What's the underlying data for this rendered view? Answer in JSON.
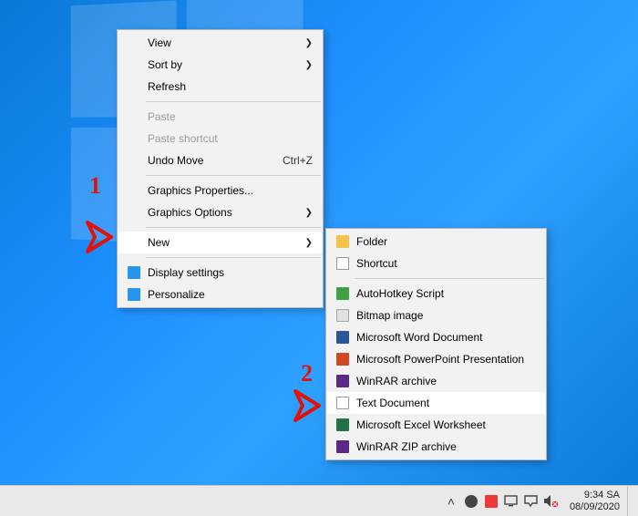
{
  "menu1": {
    "view": "View",
    "sortby": "Sort by",
    "refresh": "Refresh",
    "paste": "Paste",
    "paste_shortcut": "Paste shortcut",
    "undo_move": "Undo Move",
    "undo_accel": "Ctrl+Z",
    "gfx_props": "Graphics Properties...",
    "gfx_opts": "Graphics Options",
    "new": "New",
    "display": "Display settings",
    "personalize": "Personalize"
  },
  "menu2": {
    "folder": "Folder",
    "shortcut": "Shortcut",
    "ahk": "AutoHotkey Script",
    "bmp": "Bitmap image",
    "word": "Microsoft Word Document",
    "ppt": "Microsoft PowerPoint Presentation",
    "rar": "WinRAR archive",
    "txt": "Text Document",
    "xls": "Microsoft Excel Worksheet",
    "zip": "WinRAR ZIP archive"
  },
  "annotations": {
    "one": "1",
    "two": "2"
  },
  "taskbar": {
    "time": "9:34 SA",
    "date": "08/09/2020"
  },
  "icons": {
    "folder_color": "#f8c24a",
    "shortcut_color": "#ffffff",
    "ahk_color": "#3fa13f",
    "bmp_color": "#e0e0e0",
    "word_color": "#2b579a",
    "ppt_color": "#d24726",
    "rar_color": "#5b2a86",
    "txt_color": "#ffffff",
    "xls_color": "#217346",
    "zip_color": "#5b2a86",
    "display_color": "#2696ee",
    "personalize_color": "#2696ee"
  }
}
